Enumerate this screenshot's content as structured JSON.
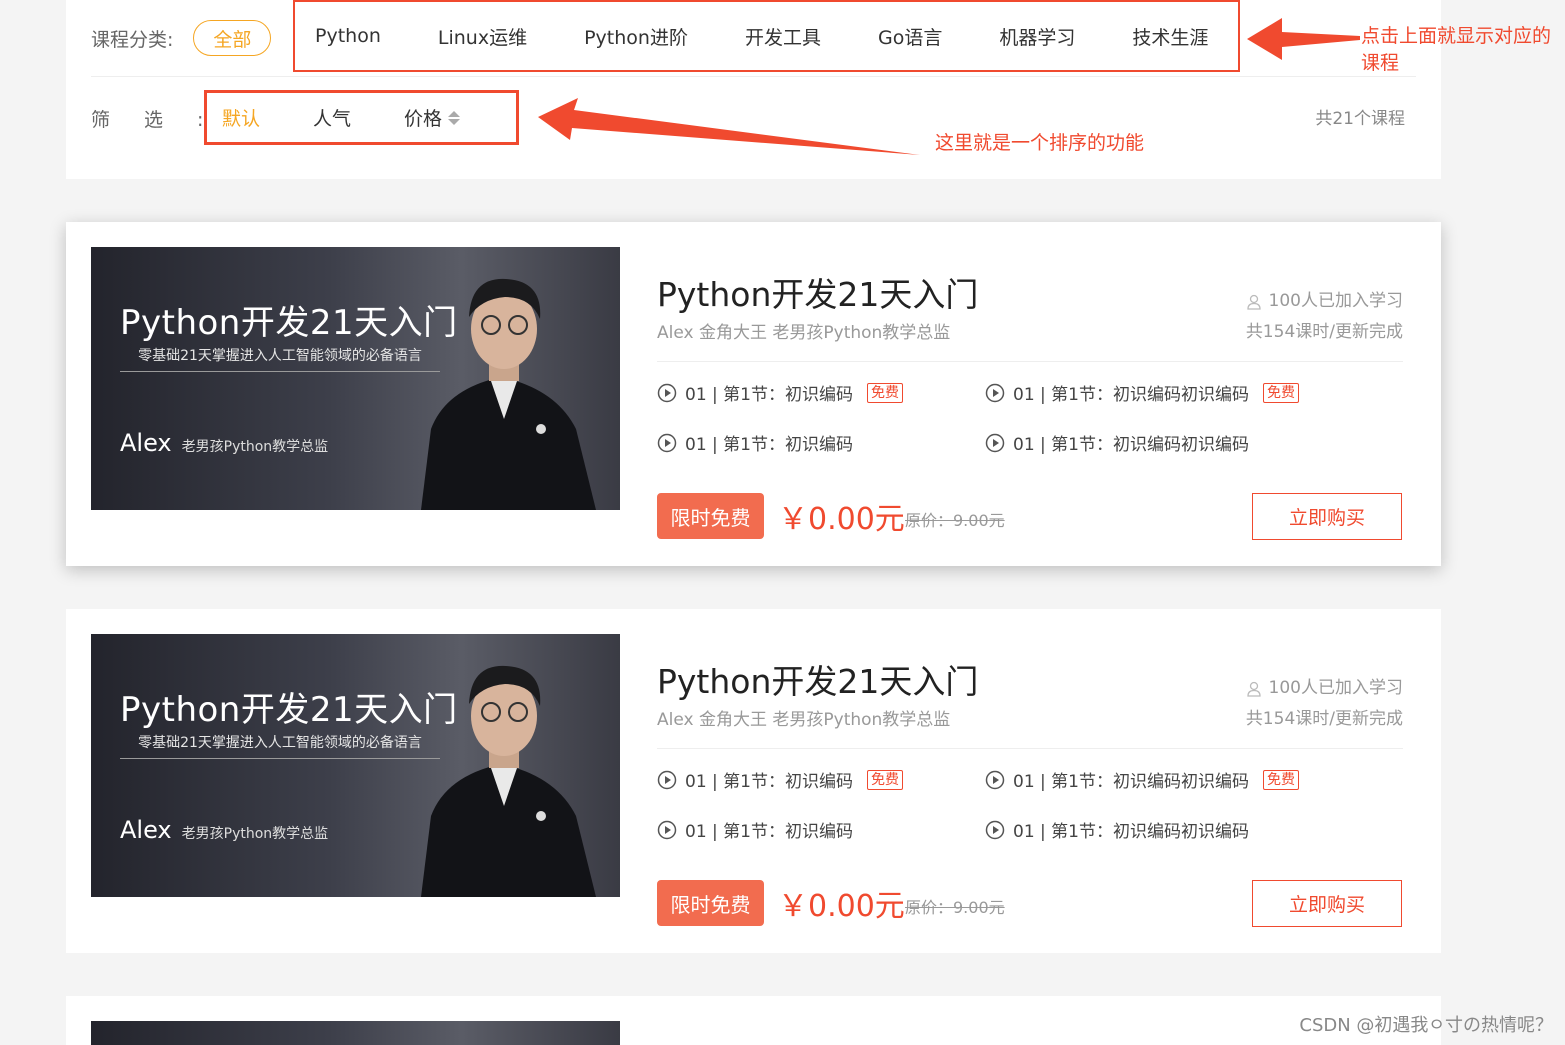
{
  "filters": {
    "category_label": "课程分类:",
    "all_label": "全部",
    "categories": [
      "Python",
      "Linux运维",
      "Python进阶",
      "开发工具",
      "Go语言",
      "机器学习",
      "技术生涯"
    ],
    "sort_label": "筛选:",
    "sort_options": [
      "默认",
      "人气",
      "价格"
    ],
    "total": "共21个课程"
  },
  "annotations": {
    "category_note": "点击上面就显示对应的课程",
    "sort_note": "这里就是一个排序的功能"
  },
  "courses": [
    {
      "thumb_title": "Python开发21天入门",
      "thumb_subtitle": "零基础21天掌握进入人工智能领域的必备语言",
      "thumb_author": "Alex",
      "thumb_role": "老男孩Python教学总监",
      "title": "Python开发21天入门",
      "teacher": "Alex 金角大王 老男孩Python教学总监",
      "learners": "100人已加入学习",
      "lessons_total": "共154课时/更新完成",
      "lessons": [
        {
          "text": "01 | 第1节：初识编码",
          "tag": "免费"
        },
        {
          "text": "01 | 第1节：初识编码初识编码",
          "tag": "免费"
        },
        {
          "text": "01 | 第1节：初识编码",
          "tag": ""
        },
        {
          "text": "01 | 第1节：初识编码初识编码",
          "tag": ""
        }
      ],
      "promo": "限时免费",
      "price": "￥0.00元",
      "original_price": "原价：9.00元",
      "buy_label": "立即购买"
    },
    {
      "thumb_title": "Python开发21天入门",
      "thumb_subtitle": "零基础21天掌握进入人工智能领域的必备语言",
      "thumb_author": "Alex",
      "thumb_role": "老男孩Python教学总监",
      "title": "Python开发21天入门",
      "teacher": "Alex 金角大王 老男孩Python教学总监",
      "learners": "100人已加入学习",
      "lessons_total": "共154课时/更新完成",
      "lessons": [
        {
          "text": "01 | 第1节：初识编码",
          "tag": "免费"
        },
        {
          "text": "01 | 第1节：初识编码初识编码",
          "tag": "免费"
        },
        {
          "text": "01 | 第1节：初识编码",
          "tag": ""
        },
        {
          "text": "01 | 第1节：初识编码初识编码",
          "tag": ""
        }
      ],
      "promo": "限时免费",
      "price": "￥0.00元",
      "original_price": "原价：9.00元",
      "buy_label": "立即购买"
    }
  ],
  "watermark": "CSDN @初遇我ㅇ寸の热情呢？",
  "colors": {
    "accent": "#f5a623",
    "annotation": "#f04a2f",
    "promo": "#f26c4f"
  }
}
